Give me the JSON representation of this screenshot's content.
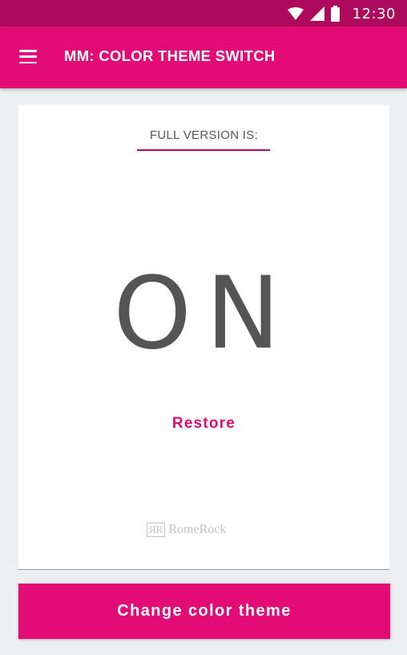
{
  "status_bar": {
    "time": "12:30",
    "icons": [
      "wifi-icon",
      "signal-icon",
      "battery-icon"
    ]
  },
  "app_bar": {
    "title": "MM: COLOR THEME SWITCH",
    "menu_icon": "menu-icon"
  },
  "card": {
    "subtitle": "FULL VERSION IS:",
    "status_value": "ON",
    "restore_label": "Restore",
    "brand": {
      "mark": "ЯR",
      "name": "RomeRock"
    }
  },
  "action": {
    "label": "Change color theme"
  },
  "colors": {
    "accent": "#e30b75",
    "status_bar": "#ad0a5d",
    "background": "#eceff1"
  }
}
